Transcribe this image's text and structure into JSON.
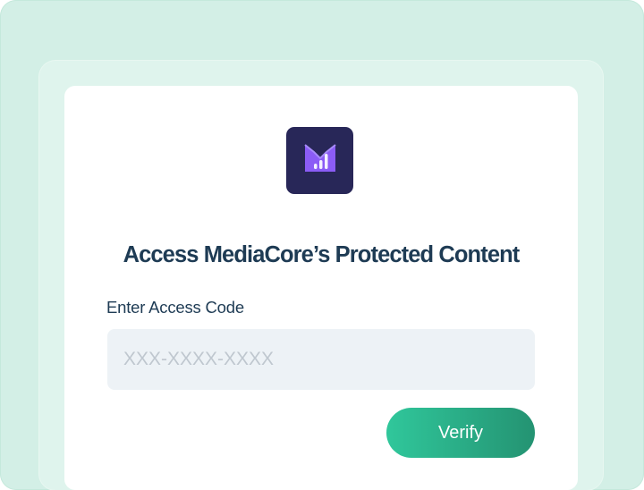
{
  "colors": {
    "outer_panel": "#d3efe6",
    "middle_panel": "#dff4ed",
    "card": "#ffffff",
    "title_text": "#1e3b54",
    "logo_background": "#282758",
    "logo_mark": "#8b5cf6",
    "input_background": "#edf2f6",
    "placeholder_text": "#bfc7cf",
    "button_gradient_start": "#30c79b",
    "button_gradient_end": "#249372"
  },
  "logo": {
    "icon": "mediacore-chart-logo-icon"
  },
  "form": {
    "title": "Access MediaCore’s Protected Content",
    "field_label": "Enter Access Code",
    "input_value": "",
    "input_placeholder": "XXX-XXXX-XXXX",
    "submit_label": "Verify"
  }
}
